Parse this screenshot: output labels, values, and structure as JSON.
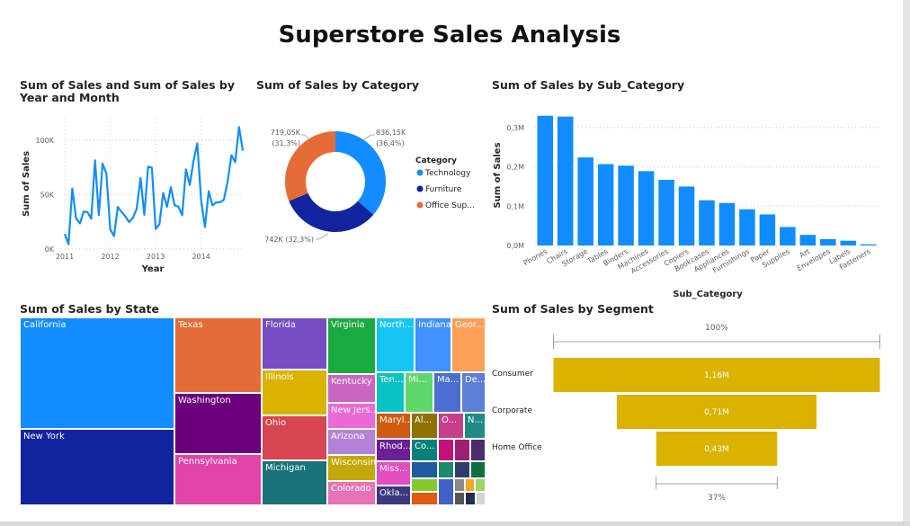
{
  "page_title": "Superstore Sales Analysis",
  "visual_titles": {
    "line": "Sum of Sales and Sum of Sales by Year and Month",
    "donut": "Sum of Sales by Category",
    "bar": "Sum of Sales by Sub_Category",
    "treemap": "Sum of Sales by State",
    "funnel": "Sum of Sales by Segment"
  },
  "colors": {
    "blue": "#118DFF",
    "navy": "#12239E",
    "orange": "#E66C37",
    "gold": "#D9B300"
  },
  "chart_data": [
    {
      "type": "line",
      "title": "Sum of Sales and Sum of Sales by Year and Month",
      "xlabel": "Year",
      "ylabel": "Sum of Sales",
      "x_ticks": [
        "2011",
        "2012",
        "2013",
        "2014"
      ],
      "y_ticks": [
        "0K",
        "50K",
        "100K"
      ],
      "ylim": [
        0,
        120000
      ],
      "grid": true,
      "series": [
        {
          "values": [
            14000,
            4500,
            55700,
            28300,
            23600,
            34600,
            33900,
            28000,
            81800,
            31400,
            78600,
            69500,
            18200,
            11900,
            38700,
            34200,
            30100,
            24800,
            28800,
            37000,
            65400,
            31500,
            75900,
            74900,
            18500,
            22900,
            51700,
            38800,
            56900,
            40300,
            39100,
            31000,
            73400,
            59000,
            81000,
            97200,
            44700,
            20300,
            53200,
            40200,
            43000,
            43100,
            45200,
            62000,
            86300,
            80000,
            112300,
            90600
          ]
        }
      ]
    },
    {
      "type": "pie",
      "title": "Sum of Sales by Category",
      "legend_title": "Category",
      "legend_position": "right",
      "categories": [
        "Technology",
        "Furniture",
        "Office Supplies"
      ],
      "legend_labels": [
        "Technology",
        "Furniture",
        "Office Sup..."
      ],
      "values": [
        836150,
        742000,
        719050
      ],
      "labels": [
        {
          "value": "836,15K",
          "pct": "(36,4%)"
        },
        {
          "value": "742K (32,3%)"
        },
        {
          "value": "719,05K",
          "pct": "(31,3%)"
        }
      ]
    },
    {
      "type": "bar",
      "title": "Sum of Sales by Sub_Category",
      "xlabel": "Sub_Category",
      "ylabel": "Sum of Sales",
      "y_ticks": [
        "0,0M",
        "0,1M",
        "0,2M",
        "0,3M"
      ],
      "ylim": [
        0,
        0.35
      ],
      "categories": [
        "Phones",
        "Chairs",
        "Storage",
        "Tables",
        "Binders",
        "Machines",
        "Accessories",
        "Copiers",
        "Bookcases",
        "Appliances",
        "Furnishings",
        "Paper",
        "Supplies",
        "Art",
        "Envelopes",
        "Labels",
        "Fasteners"
      ],
      "values": [
        0.33,
        0.328,
        0.224,
        0.207,
        0.203,
        0.189,
        0.167,
        0.15,
        0.115,
        0.108,
        0.092,
        0.079,
        0.047,
        0.027,
        0.016,
        0.012,
        0.003
      ]
    },
    {
      "type": "heatmap",
      "title": "Sum of Sales by State",
      "states": [
        "California",
        "New York",
        "Texas",
        "Washington",
        "Pennsylvania",
        "Florida",
        "Illinois",
        "Ohio",
        "Michigan",
        "Virginia",
        "Kentucky",
        "New Jers...",
        "Arizona",
        "Wisconsin",
        "Colorado",
        "North...",
        "Indiana",
        "Geor...",
        "Ten...",
        "Mi...",
        "Ma...",
        "De...",
        "Maryl...",
        "Al...",
        "O...",
        "N...",
        "Rhod...",
        "Co...",
        "Miss...",
        "Okla..."
      ]
    },
    {
      "type": "bar",
      "title": "Sum of Sales by Segment",
      "subtype": "funnel",
      "categories": [
        "Consumer",
        "Corporate",
        "Home Office"
      ],
      "values": [
        1.16,
        0.71,
        0.43
      ],
      "value_labels": [
        "1,16M",
        "0,71M",
        "0,43M"
      ],
      "top_pct": "100%",
      "bottom_pct": "37%"
    }
  ]
}
